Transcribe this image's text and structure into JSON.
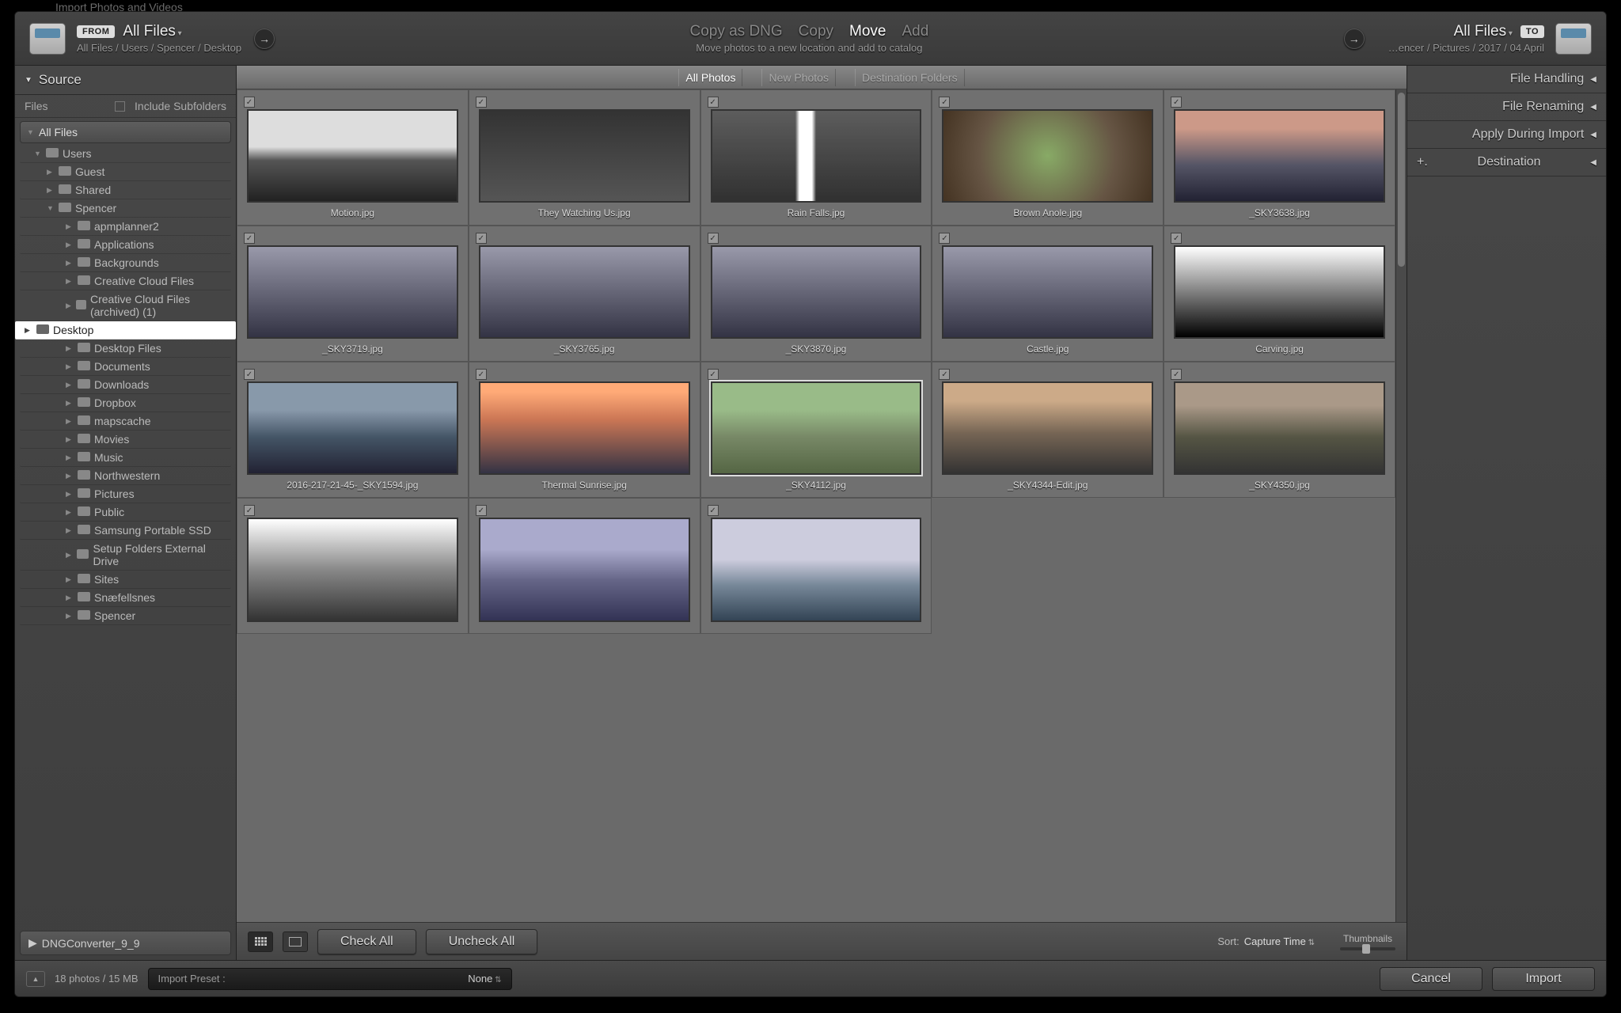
{
  "window_title": "Import Photos and Videos",
  "header": {
    "from": {
      "badge": "FROM",
      "main": "All Files",
      "path": "All Files / Users / Spencer / Desktop"
    },
    "to": {
      "badge": "TO",
      "main": "All Files",
      "path": "…encer / Pictures / 2017 / 04 April"
    },
    "modes": [
      "Copy as DNG",
      "Copy",
      "Move",
      "Add"
    ],
    "mode_active": 2,
    "mode_desc": "Move photos to a new location and add to catalog"
  },
  "left": {
    "panel_title": "Source",
    "files_label": "Files",
    "include_subfolders": "Include Subfolders",
    "all_files": "All Files",
    "tree": [
      {
        "label": "Users",
        "indent": 1,
        "open": true
      },
      {
        "label": "Guest",
        "indent": 2
      },
      {
        "label": "Shared",
        "indent": 2
      },
      {
        "label": "Spencer",
        "indent": 2,
        "open": true
      },
      {
        "label": "apmplanner2",
        "indent": 3
      },
      {
        "label": "Applications",
        "indent": 3
      },
      {
        "label": "Backgrounds",
        "indent": 3
      },
      {
        "label": "Creative Cloud Files",
        "indent": 3
      },
      {
        "label": "Creative Cloud Files (archived) (1)",
        "indent": 3
      },
      {
        "label": "Desktop",
        "indent": 3,
        "selected": true
      },
      {
        "label": "Desktop Files",
        "indent": 3
      },
      {
        "label": "Documents",
        "indent": 3
      },
      {
        "label": "Downloads",
        "indent": 3
      },
      {
        "label": "Dropbox",
        "indent": 3
      },
      {
        "label": "mapscache",
        "indent": 3
      },
      {
        "label": "Movies",
        "indent": 3
      },
      {
        "label": "Music",
        "indent": 3
      },
      {
        "label": "Northwestern",
        "indent": 3
      },
      {
        "label": "Pictures",
        "indent": 3
      },
      {
        "label": "Public",
        "indent": 3
      },
      {
        "label": "Samsung Portable SSD",
        "indent": 3
      },
      {
        "label": "Setup Folders External Drive",
        "indent": 3
      },
      {
        "label": "Sites",
        "indent": 3
      },
      {
        "label": "Snæfellsnes",
        "indent": 3
      },
      {
        "label": "Spencer",
        "indent": 3
      }
    ],
    "dng_converter": "DNGConverter_9_9"
  },
  "tabs": {
    "items": [
      "All Photos",
      "New Photos",
      "Destination Folders"
    ],
    "active": 0
  },
  "thumbs": [
    {
      "name": "Motion.jpg",
      "t": 0
    },
    {
      "name": "They Watching Us.jpg",
      "t": 1
    },
    {
      "name": "Rain Falls.jpg",
      "t": 2
    },
    {
      "name": "Brown Anole.jpg",
      "t": 3
    },
    {
      "name": "_SKY3638.jpg",
      "t": 4
    },
    {
      "name": "_SKY3719.jpg",
      "t": 5
    },
    {
      "name": "_SKY3765.jpg",
      "t": 5
    },
    {
      "name": "_SKY3870.jpg",
      "t": 5
    },
    {
      "name": "Castle.jpg",
      "t": 5
    },
    {
      "name": "Carving.jpg",
      "t": 6
    },
    {
      "name": "2016-217-21-45-_SKY1594.jpg",
      "t": 7
    },
    {
      "name": "Thermal Sunrise.jpg",
      "t": 8
    },
    {
      "name": "_SKY4112.jpg",
      "t": 9,
      "sel": true
    },
    {
      "name": "_SKY4344-Edit.jpg",
      "t": 10
    },
    {
      "name": "_SKY4350.jpg",
      "t": 11
    },
    {
      "name": "",
      "t": 12
    },
    {
      "name": "",
      "t": 13
    },
    {
      "name": "",
      "t": 14
    }
  ],
  "ctool": {
    "check_all": "Check All",
    "uncheck_all": "Uncheck All",
    "sort_label": "Sort:",
    "sort_value": "Capture Time",
    "thumbs_label": "Thumbnails"
  },
  "right": {
    "rows": [
      "File Handling",
      "File Renaming",
      "Apply During Import",
      "Destination"
    ],
    "plus": "+."
  },
  "footer": {
    "info": "18 photos / 15 MB",
    "preset_label": "Import Preset :",
    "preset_value": "None",
    "cancel": "Cancel",
    "import": "Import"
  }
}
